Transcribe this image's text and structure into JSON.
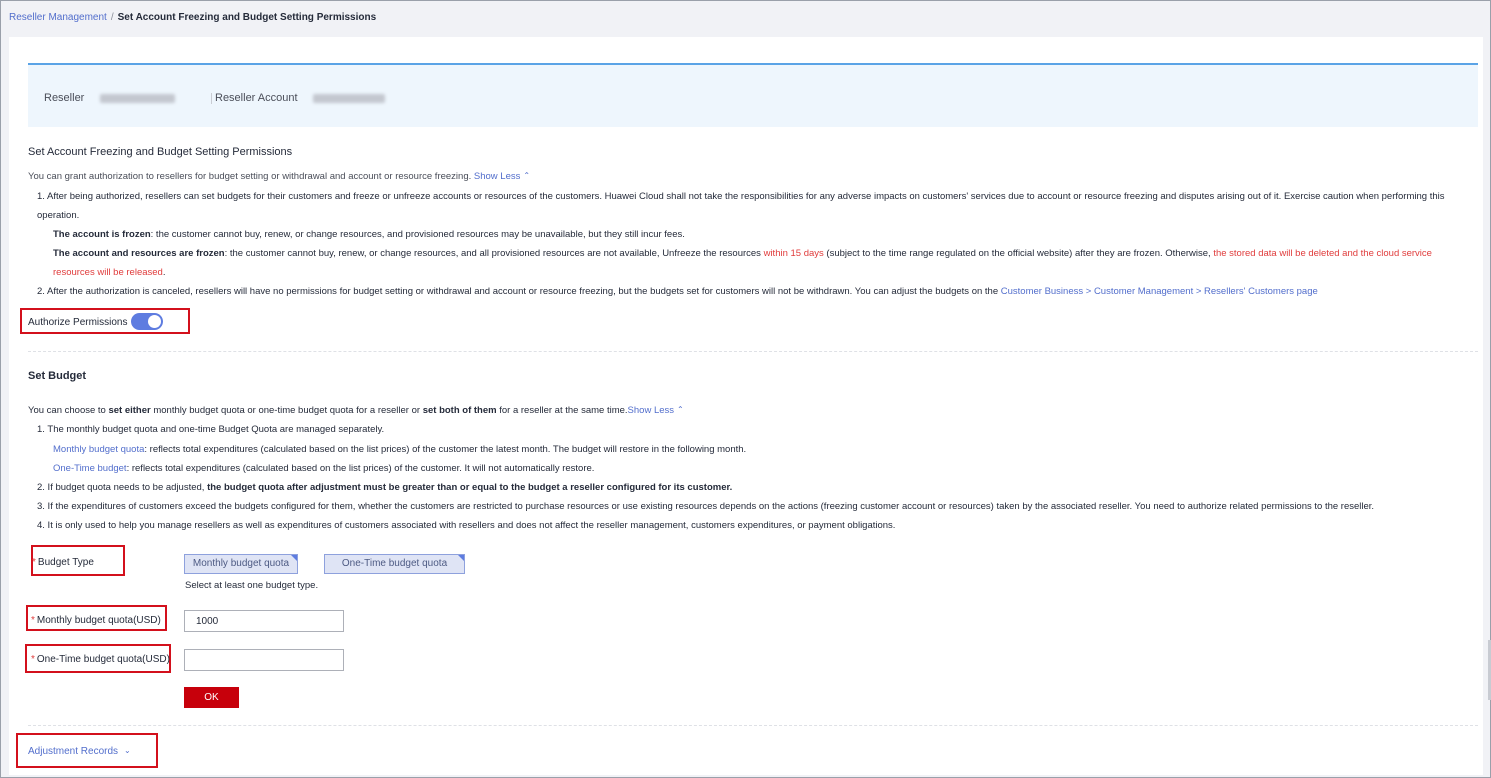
{
  "breadcrumb": {
    "parent": "Reseller Management",
    "separator": "/",
    "current": "Set Account Freezing and Budget Setting Permissions"
  },
  "info": {
    "reseller_label": "Reseller",
    "reseller_account_label": "Reseller Account"
  },
  "permissions": {
    "title": "Set Account Freezing and Budget Setting Permissions",
    "intro": "You can grant authorization to resellers for budget setting or withdrawal and account or resource freezing.",
    "show_less": "Show Less",
    "item1_a": "1. After being authorized, resellers can set budgets for their customers and freeze or unfreeze accounts or resources of the customers. Huawei Cloud shall not take the responsibilities for any adverse impacts on customers' services due to account or resource freezing and disputes arising out of it. Exercise caution when performing this",
    "item1_b": "operation.",
    "frozen_bold": "The account is frozen",
    "frozen_text": ": the customer cannot buy, renew, or change resources, and provisioned resources may be unavailable, but they still incur fees.",
    "frozen_res_bold": "The account and resources are frozen",
    "frozen_res_text1": ": the customer cannot buy, renew, or change resources, and all provisioned resources are not available, Unfreeze the resources ",
    "frozen_res_red1": "within 15 days",
    "frozen_res_text2": " (subject to the time range regulated on the official website) after they are frozen. Otherwise, ",
    "frozen_res_red2a": "the stored data will be deleted and the cloud service",
    "frozen_res_red2b": "resources will be released",
    "period": ".",
    "item2_text": "2. After the authorization is canceled, resellers will have no permissions for budget setting or withdrawal and account or resource freezing, but the budgets set for customers will not be withdrawn. You can adjust the budgets on the ",
    "item2_link": "Customer Business > Customer Management > Resellers' Customers page",
    "authorize_label": "Authorize Permissions",
    "authorize_on": true
  },
  "budget": {
    "title": "Set Budget",
    "intro_1": "You can choose to ",
    "intro_b1": "set either",
    "intro_2": " monthly budget quota or one-time budget quota for a reseller or ",
    "intro_b2": "set both of them",
    "intro_3": " for a reseller at the same time.",
    "show_less": "Show Less",
    "item1": "1. The monthly budget quota and one-time Budget Quota are managed separately.",
    "monthly_link": "Monthly budget quota",
    "monthly_text": ": reflects total expenditures (calculated based on the list prices) of the customer the latest month. The budget will restore in the following month.",
    "onetime_link": "One-Time budget",
    "onetime_text": ": reflects total expenditures (calculated based on the list prices) of the customer. It will not automatically restore.",
    "item2_text": "2. If budget quota needs to be adjusted, ",
    "item2_bold": "the budget quota after adjustment must be greater than or equal to the budget a reseller configured for its customer",
    "item3": "3. If the expenditures of customers exceed the budgets configured for them, whether the customers are restricted to purchase resources or use existing resources depends on the actions (freezing customer account or resources) taken by the associated reseller. You need to authorize related permissions to the reseller.",
    "item4": "4. It is only used to help you manage resellers as well as expenditures of customers associated with resellers and does not affect the reseller management, customers expenditures, or payment obligations."
  },
  "form": {
    "required_mark": "*",
    "budget_type_label": "Budget Type",
    "option_monthly": "Monthly budget quota",
    "option_onetime": "One-Time budget quota",
    "budget_type_hint": "Select at least one budget type.",
    "monthly_label": "Monthly budget quota(USD)",
    "monthly_value": "1000",
    "onetime_label": "One-Time budget quota(USD)",
    "onetime_value": "",
    "ok_label": "OK"
  },
  "adjustment": {
    "label": "Adjustment Records"
  },
  "colors": {
    "accent": "#5e7ce0",
    "link": "#526ecc",
    "warning": "#e03c3c",
    "primary_button": "#c7000b",
    "highlight_box": "#d3101c"
  }
}
